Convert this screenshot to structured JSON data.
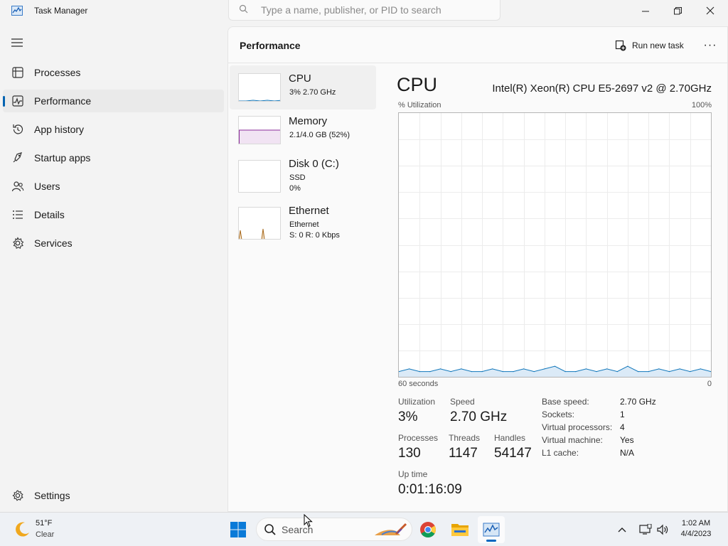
{
  "window": {
    "title": "Task Manager"
  },
  "search": {
    "placeholder": "Type a name, publisher, or PID to search"
  },
  "nav": {
    "items": [
      {
        "label": "Processes"
      },
      {
        "label": "Performance"
      },
      {
        "label": "App history"
      },
      {
        "label": "Startup apps"
      },
      {
        "label": "Users"
      },
      {
        "label": "Details"
      },
      {
        "label": "Services"
      }
    ],
    "selected": "Performance",
    "settings_label": "Settings"
  },
  "header": {
    "title": "Performance",
    "run_new_task": "Run new task",
    "more": "···"
  },
  "list": [
    {
      "name": "CPU",
      "sub1": "3% 2.70 GHz",
      "sub2": ""
    },
    {
      "name": "Memory",
      "sub1": "2.1/4.0 GB (52%)",
      "sub2": ""
    },
    {
      "name": "Disk 0 (C:)",
      "sub1": "SSD",
      "sub2": "0%"
    },
    {
      "name": "Ethernet",
      "sub1": "Ethernet",
      "sub2": "S: 0 R: 0 Kbps"
    }
  ],
  "detail": {
    "title": "CPU",
    "model": "Intel(R) Xeon(R) CPU E5-2697 v2 @ 2.70GHz",
    "y_label": "% Utilization",
    "y_max_label": "100%",
    "x_left_label": "60 seconds",
    "x_right_label": "0",
    "stats": {
      "utilization_label": "Utilization",
      "utilization": "3%",
      "speed_label": "Speed",
      "speed": "2.70 GHz",
      "processes_label": "Processes",
      "processes": "130",
      "threads_label": "Threads",
      "threads": "1147",
      "handles_label": "Handles",
      "handles": "54147",
      "uptime_label": "Up time",
      "uptime": "0:01:16:09"
    },
    "specs": [
      {
        "key": "Base speed:",
        "value": "2.70 GHz"
      },
      {
        "key": "Sockets:",
        "value": "1"
      },
      {
        "key": "Virtual processors:",
        "value": "4"
      },
      {
        "key": "Virtual machine:",
        "value": "Yes"
      },
      {
        "key": "L1 cache:",
        "value": "N/A"
      }
    ]
  },
  "chart_data": {
    "type": "line",
    "title": "",
    "xlabel": "",
    "ylabel": "% Utilization",
    "ylim": [
      0,
      100
    ],
    "xlim": [
      60,
      0
    ],
    "x": [
      60,
      58,
      56,
      54,
      52,
      50,
      48,
      46,
      44,
      42,
      40,
      38,
      36,
      34,
      32,
      30,
      28,
      26,
      24,
      22,
      20,
      18,
      16,
      14,
      12,
      10,
      8,
      6,
      4,
      2,
      0
    ],
    "series": [
      {
        "values": [
          2,
          3,
          2,
          2,
          3,
          2,
          3,
          2,
          2,
          3,
          2,
          2,
          3,
          2,
          3,
          4,
          2,
          2,
          3,
          2,
          3,
          2,
          4,
          2,
          2,
          3,
          2,
          3,
          2,
          3,
          2
        ]
      }
    ],
    "colors": {
      "cpu": "#1177bb"
    }
  },
  "taskbar": {
    "weather_temp": "51°F",
    "weather_desc": "Clear",
    "search_label": "Search",
    "time": "1:02 AM",
    "date": "4/4/2023"
  }
}
